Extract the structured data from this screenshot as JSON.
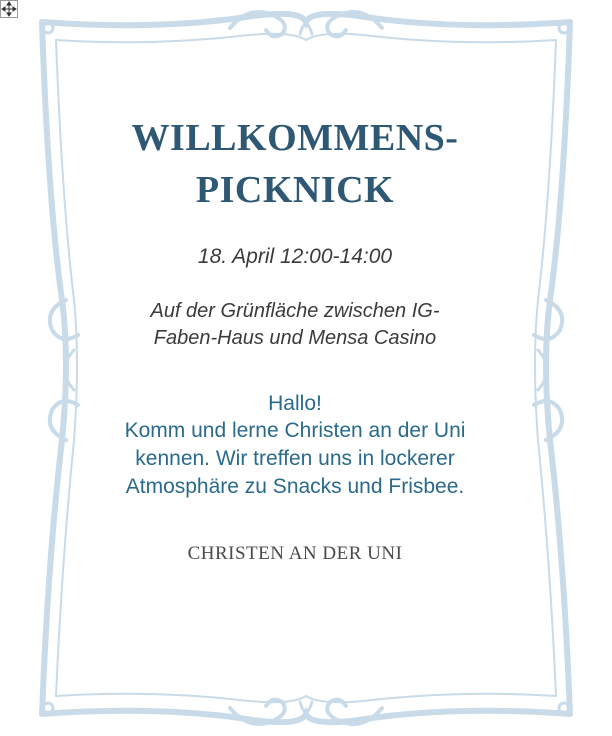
{
  "flyer": {
    "title": "WILLKOMMENS-PICKNICK",
    "date_time": "18. April  12:00-14:00",
    "location": "Auf der Grünfläche zwischen IG-Faben-Haus und Mensa Casino",
    "greeting": "Hallo!",
    "message": "Komm und lerne Christen an der Uni kennen. Wir treffen uns in lockerer Atmosphäre zu Snacks und Frisbee.",
    "organization": "CHRISTEN AN DER UNI"
  },
  "colors": {
    "title": "#2e5873",
    "message": "#2a6a8c",
    "frame": "#c9dbe8",
    "text": "#3b3b3b"
  },
  "icons": [
    "move-handle-icon",
    "ornamental-frame"
  ]
}
